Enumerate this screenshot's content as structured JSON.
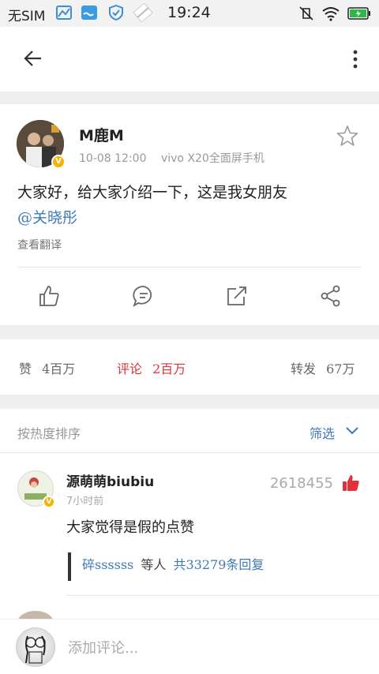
{
  "status_bar": {
    "carrier": "无SIM",
    "time": "19:24"
  },
  "post": {
    "username": "M鹿M",
    "date": "10-08 12:00",
    "device": "vivo X20全面屏手机",
    "content_text": "大家好，给大家介绍一下，这是我女朋友",
    "mention": "@关晓彤",
    "translate_label": "查看翻译"
  },
  "stats": {
    "likes_label": "赞",
    "likes_count": "4百万",
    "comments_label": "评论",
    "comments_count": "2百万",
    "reposts_label": "转发",
    "reposts_count": "67万"
  },
  "sort": {
    "label": "按热度排序",
    "filter_label": "筛选"
  },
  "comments": [
    {
      "username": "源萌萌biubiu",
      "time": "7小时前",
      "likes": "2618455",
      "text": "大家觉得是假的点赞",
      "reply_name": "碎ssssss",
      "reply_mid": "等人",
      "reply_count": "共33279条回复"
    }
  ],
  "input": {
    "placeholder": "添加评论..."
  },
  "colors": {
    "link_blue": "#3d79b8",
    "accent_red": "#e0323a",
    "badge_gold": "#f4b400",
    "divider_gray": "#efefef"
  }
}
